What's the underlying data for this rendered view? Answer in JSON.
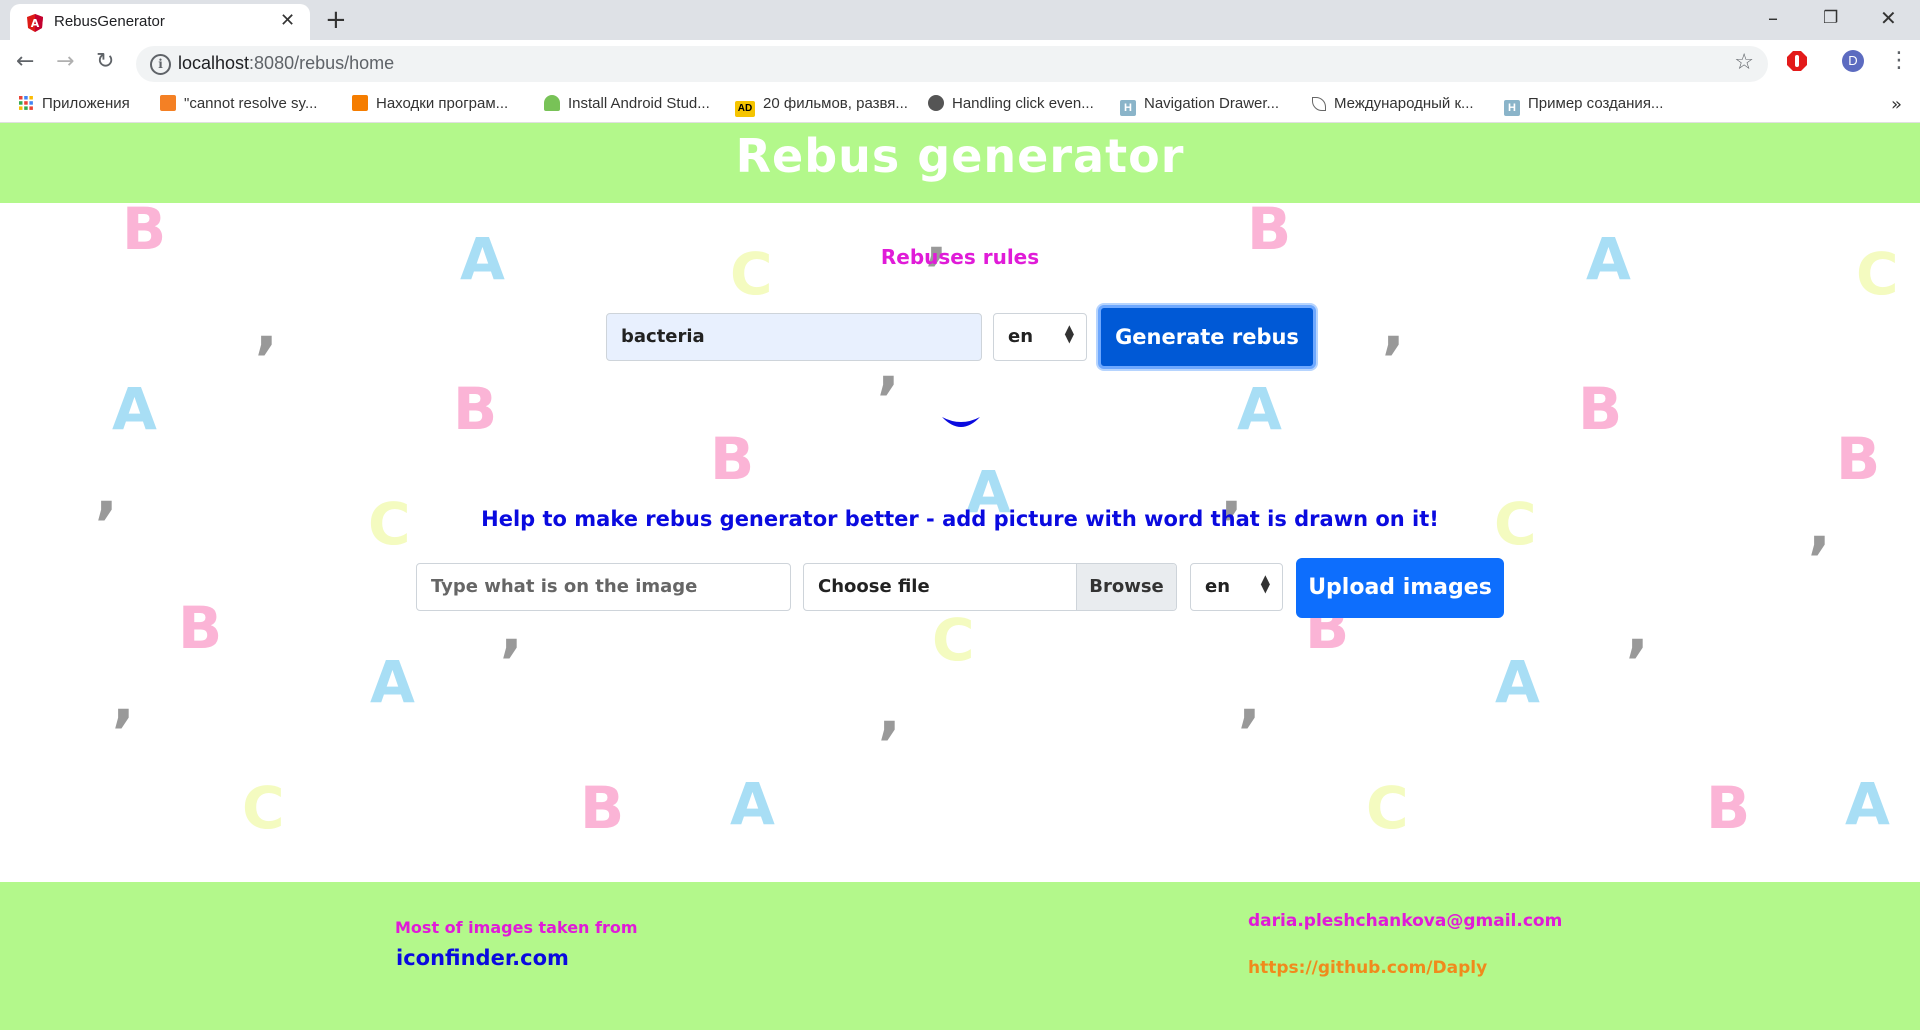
{
  "browser": {
    "tab_title": "RebusGenerator",
    "url_host": "localhost",
    "url_path": ":8080/rebus/home",
    "profile_initial": "D",
    "bookmarks": [
      {
        "label": "Приложения",
        "icon": "apps-grid-icon"
      },
      {
        "label": "\"cannot resolve sy...",
        "icon": "stackoverflow-icon"
      },
      {
        "label": "Находки програм...",
        "icon": "blogger-icon"
      },
      {
        "label": "Install Android Stud...",
        "icon": "android-icon"
      },
      {
        "label": "20 фильмов, развя...",
        "icon": "ad-icon"
      },
      {
        "label": "Handling click even...",
        "icon": "globe-icon"
      },
      {
        "label": "Navigation Drawer...",
        "icon": "h-icon"
      },
      {
        "label": "Международный к...",
        "icon": "feather-icon"
      },
      {
        "label": "Пример создания...",
        "icon": "h-icon"
      }
    ]
  },
  "app": {
    "title": "Rebus generator",
    "rules_link": "Rebuses rules",
    "word_value": "bacteria",
    "lang_selected": "en",
    "generate_label": "Generate rebus",
    "help_text": "Help to make rebus generator better - add picture with word that is drawn on it!",
    "image_word_placeholder": "Type what is on the image",
    "file_label": "Choose file",
    "browse_label": "Browse",
    "upload_lang_selected": "en",
    "upload_label": "Upload images"
  },
  "footer": {
    "images_note": "Most of images taken from",
    "images_link": "iconfinder.com",
    "email": "daria.pleshchankova@gmail.com",
    "github": "https://github.com/Daply"
  },
  "background_letters": [
    "A",
    "B",
    "C",
    ","
  ],
  "colors": {
    "header_green": "#b3f88b",
    "primary_blue": "#0d6efd",
    "magenta": "#e01bd8",
    "deep_blue": "#0a0adf",
    "orange": "#f08a1c"
  }
}
